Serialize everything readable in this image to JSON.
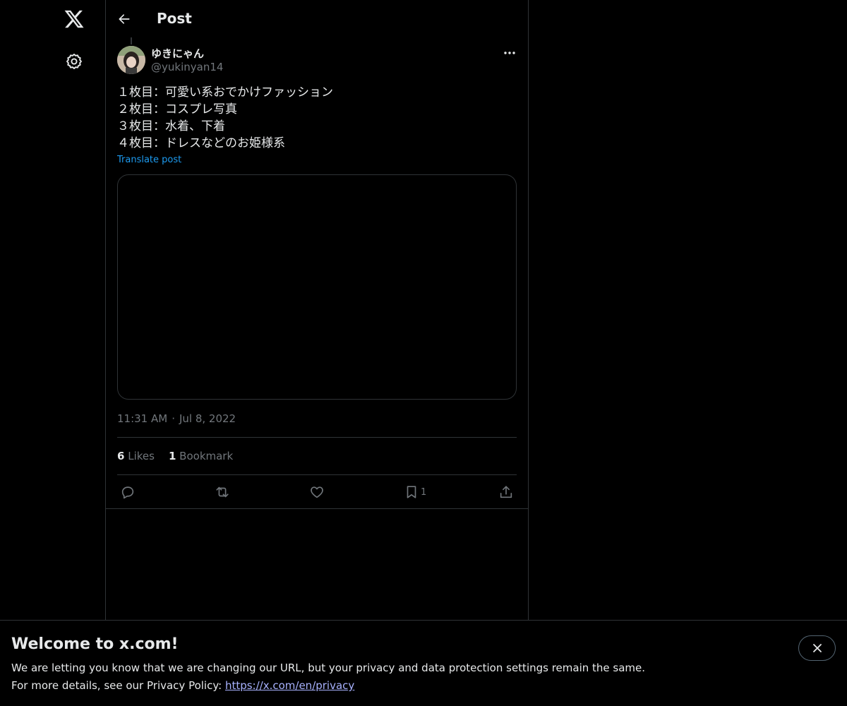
{
  "nav": {
    "logo_icon": "x-logo-icon",
    "settings_icon": "gear-icon"
  },
  "header": {
    "title": "Post",
    "back_icon": "arrow-left-icon"
  },
  "post": {
    "author_name": "ゆきにゃん",
    "author_handle": "@yukinyan14",
    "text_lines": [
      "１枚目：可愛い系おでかけファッション",
      "２枚目：コスプレ写真",
      "３枚目：水着、下着",
      "４枚目：ドレスなどのお姫様系"
    ],
    "translate_label": "Translate post",
    "time": "11:31 AM",
    "separator": "·",
    "date": "Jul 8, 2022",
    "stats": {
      "likes_count": "6",
      "likes_label": "Likes",
      "bookmarks_count": "1",
      "bookmarks_label": "Bookmark"
    },
    "actions": {
      "reply_icon": "reply-icon",
      "repost_icon": "repost-icon",
      "like_icon": "heart-icon",
      "bookmark_icon": "bookmark-icon",
      "bookmark_count": "1",
      "share_icon": "share-icon"
    }
  },
  "banner": {
    "title": "Welcome to x.com!",
    "line1": "We are letting you know that we are changing our URL, but your privacy and data protection settings remain the same.",
    "line2_prefix": "For more details, see our Privacy Policy: ",
    "link_text": "https://x.com/en/privacy",
    "close_icon": "close-icon"
  },
  "colors": {
    "background": "#000000",
    "text_primary": "#e7e9ea",
    "text_secondary": "#71767b",
    "accent": "#1d9bf0",
    "border": "#2f3336"
  }
}
